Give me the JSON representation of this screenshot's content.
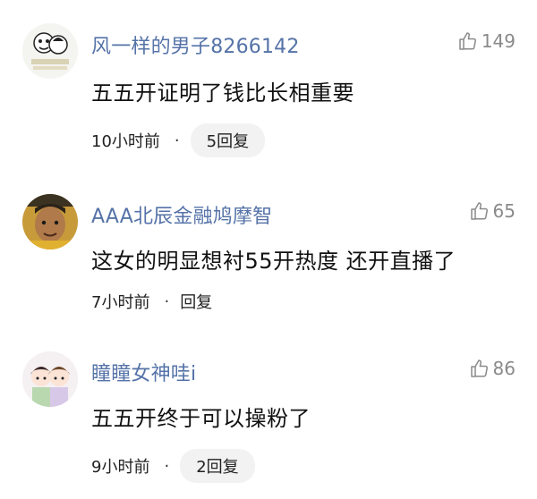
{
  "comments": [
    {
      "username": "风一样的男子8266142",
      "likes": "149",
      "text": "五五开证明了钱比长相重要",
      "time": "10小时前",
      "separator": "·",
      "reply": "5回复"
    },
    {
      "username": "AAA北辰金融鸠摩智",
      "likes": "65",
      "text": "这女的明显想衬55开热度  还开直播了",
      "time": "7小时前",
      "separator": "·",
      "reply": "回复"
    },
    {
      "username": "瞳瞳女神哇i",
      "likes": "86",
      "text": "五五开终于可以操粉了",
      "time": "9小时前",
      "separator": "·",
      "reply": "2回复"
    }
  ],
  "icons": {
    "like": "thumbs-up-icon"
  },
  "colors": {
    "username": "#5573a8",
    "likes": "#8a8a8a",
    "text": "#111111",
    "pill": "#f2f2f2"
  }
}
